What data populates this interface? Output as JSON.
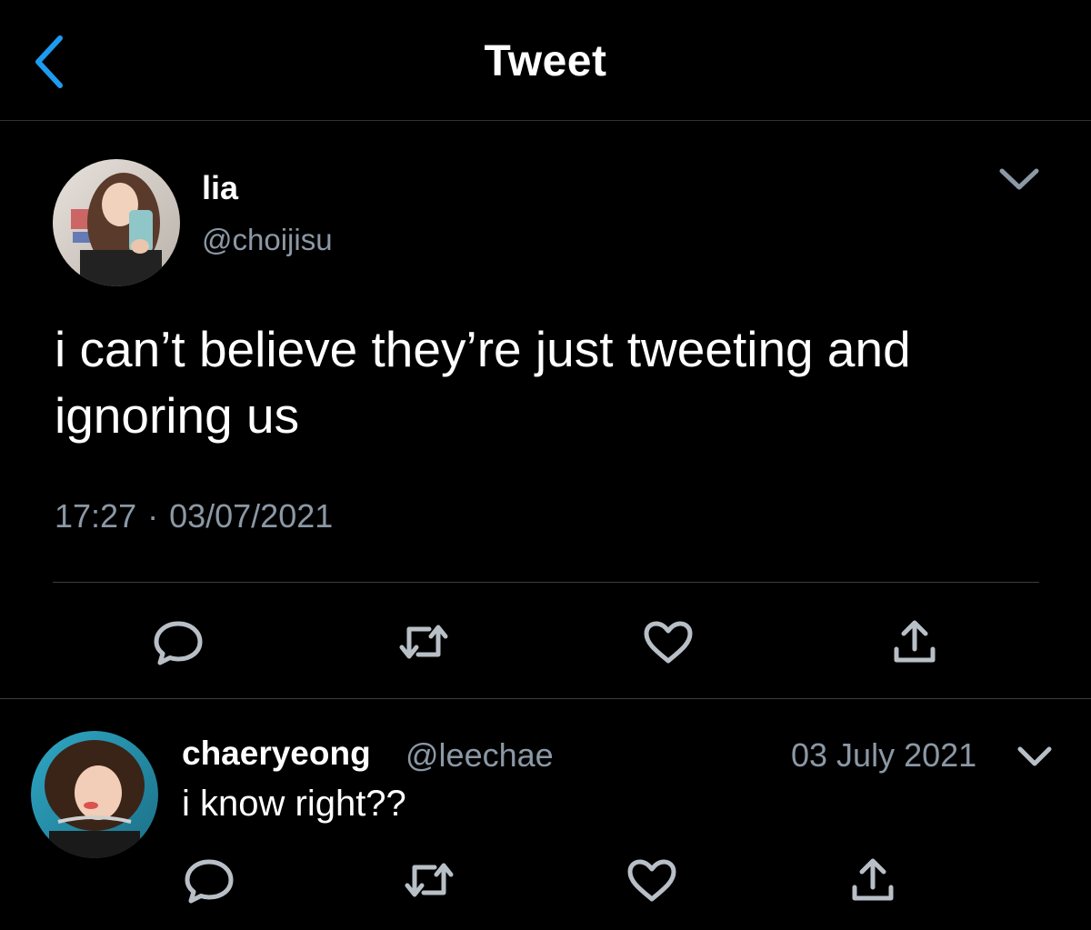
{
  "header": {
    "title": "Tweet",
    "back_icon": "chevron-left-icon",
    "accent_color": "#1d9bf0"
  },
  "main_tweet": {
    "author_name": "lia",
    "author_handle": "@choijisu",
    "text_line1": "i can’t believe they’re just tweeting and",
    "text_line2": "ignoring us",
    "time": "17:27",
    "date": "03/07/2021",
    "separator": "·",
    "menu_icon": "chevron-down-icon",
    "actions": [
      "reply-icon",
      "retweet-icon",
      "like-icon",
      "share-icon"
    ]
  },
  "reply": {
    "author_name": "chaeryeong",
    "author_handle": "@leechae",
    "date": "03 July 2021",
    "text": "i know right??",
    "menu_icon": "chevron-down-icon",
    "actions": [
      "reply-icon",
      "retweet-icon",
      "like-icon",
      "share-icon"
    ]
  },
  "colors": {
    "background": "#000000",
    "primary_text": "#ffffff",
    "secondary_text": "#8b98a5",
    "divider": "#3a3f44",
    "icon": "#b8bfc6"
  }
}
